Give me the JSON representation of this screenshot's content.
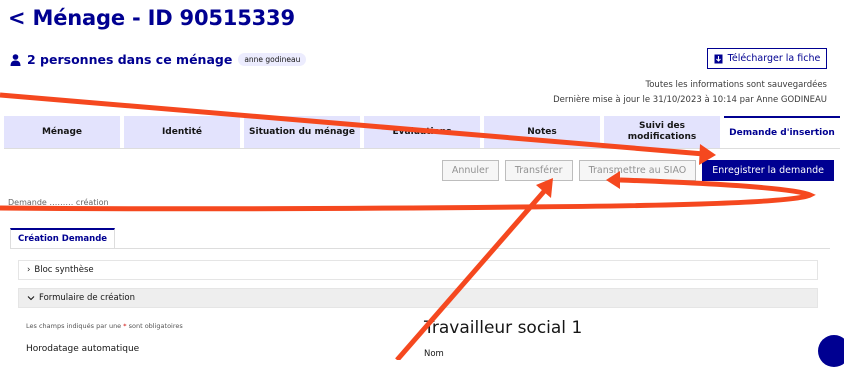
{
  "header": {
    "title_prefix": "<",
    "title": "Ménage - ID 90515339",
    "persons": "2 personnes dans ce ménage",
    "badge": "anne godineau",
    "download_button": "Télécharger la fiche",
    "save_status": "Toutes les informations sont sauvegardées",
    "last_update": "Dernière mise à jour le 31/10/2023 à 10:14 par Anne GODINEAU"
  },
  "tabs": [
    {
      "label": "Ménage"
    },
    {
      "label": "Identité"
    },
    {
      "label": "Situation du ménage"
    },
    {
      "label": "Evaluations"
    },
    {
      "label": "Notes"
    },
    {
      "label": "Suivi des modifications"
    },
    {
      "label": "Demande d'insertion",
      "active": true
    }
  ],
  "actions": {
    "cancel": "Annuler",
    "transfer": "Transférer",
    "transmit": "Transmettre au SIAO",
    "submit": "Enregistrer la demande"
  },
  "form": {
    "hidden_text": "Demande ……… création",
    "subtab": "Création Demande",
    "accordion_summary": "Bloc synthèse",
    "accordion_form": "Formulaire de création",
    "required_note_before": "Les champs indiqués par une",
    "required_star": "*",
    "required_note_after": "sont obligatoires",
    "timestamp_label": "Horodatage automatique",
    "section_title": "Travailleur social 1",
    "name_label": "Nom"
  },
  "colors": {
    "primary": "#000091",
    "tab_bg": "#e3e3fd",
    "annotation_arrow": "#f5481f"
  },
  "icons": {
    "back": "chevron-left-icon",
    "person": "person-icon",
    "download": "download-icon",
    "collapsed": "chevron-right-icon",
    "expanded": "chevron-down-icon",
    "chat": "chat-icon"
  }
}
